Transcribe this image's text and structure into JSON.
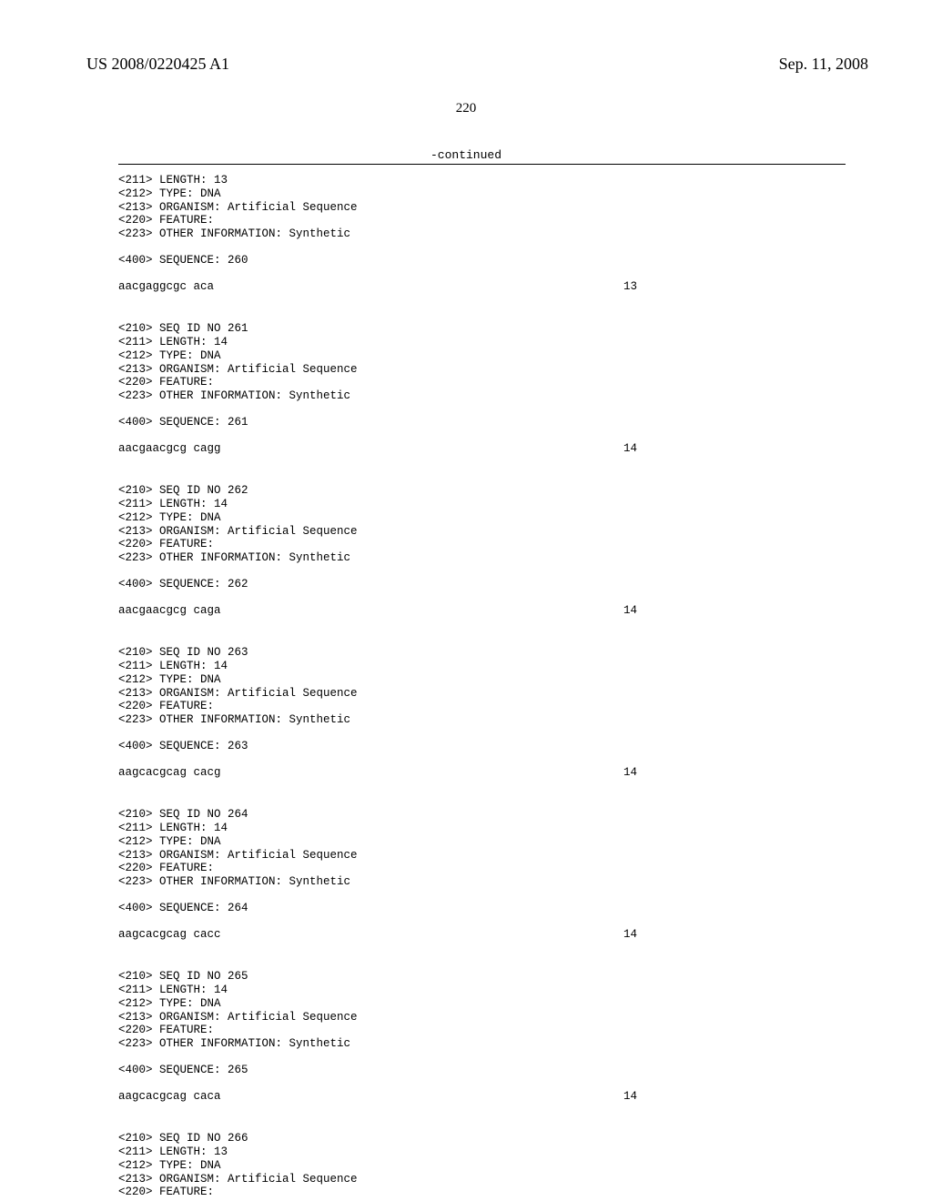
{
  "header": {
    "left": "US 2008/0220425 A1",
    "right": "Sep. 11, 2008"
  },
  "pageNumber": "220",
  "continued": "-continued",
  "blocks": [
    {
      "isFirst": true,
      "meta": [
        "<211> LENGTH: 13",
        "<212> TYPE: DNA",
        "<213> ORGANISM: Artificial Sequence",
        "<220> FEATURE:",
        "<223> OTHER INFORMATION: Synthetic"
      ],
      "seqLabel": "<400> SEQUENCE: 260",
      "sequence": "aacgaggcgc aca",
      "length": "13"
    },
    {
      "meta": [
        "<210> SEQ ID NO 261",
        "<211> LENGTH: 14",
        "<212> TYPE: DNA",
        "<213> ORGANISM: Artificial Sequence",
        "<220> FEATURE:",
        "<223> OTHER INFORMATION: Synthetic"
      ],
      "seqLabel": "<400> SEQUENCE: 261",
      "sequence": "aacgaacgcg cagg",
      "length": "14"
    },
    {
      "meta": [
        "<210> SEQ ID NO 262",
        "<211> LENGTH: 14",
        "<212> TYPE: DNA",
        "<213> ORGANISM: Artificial Sequence",
        "<220> FEATURE:",
        "<223> OTHER INFORMATION: Synthetic"
      ],
      "seqLabel": "<400> SEQUENCE: 262",
      "sequence": "aacgaacgcg caga",
      "length": "14"
    },
    {
      "meta": [
        "<210> SEQ ID NO 263",
        "<211> LENGTH: 14",
        "<212> TYPE: DNA",
        "<213> ORGANISM: Artificial Sequence",
        "<220> FEATURE:",
        "<223> OTHER INFORMATION: Synthetic"
      ],
      "seqLabel": "<400> SEQUENCE: 263",
      "sequence": "aagcacgcag cacg",
      "length": "14"
    },
    {
      "meta": [
        "<210> SEQ ID NO 264",
        "<211> LENGTH: 14",
        "<212> TYPE: DNA",
        "<213> ORGANISM: Artificial Sequence",
        "<220> FEATURE:",
        "<223> OTHER INFORMATION: Synthetic"
      ],
      "seqLabel": "<400> SEQUENCE: 264",
      "sequence": "aagcacgcag cacc",
      "length": "14"
    },
    {
      "meta": [
        "<210> SEQ ID NO 265",
        "<211> LENGTH: 14",
        "<212> TYPE: DNA",
        "<213> ORGANISM: Artificial Sequence",
        "<220> FEATURE:",
        "<223> OTHER INFORMATION: Synthetic"
      ],
      "seqLabel": "<400> SEQUENCE: 265",
      "sequence": "aagcacgcag caca",
      "length": "14"
    },
    {
      "isLast": true,
      "meta": [
        "<210> SEQ ID NO 266",
        "<211> LENGTH: 13",
        "<212> TYPE: DNA",
        "<213> ORGANISM: Artificial Sequence",
        "<220> FEATURE:"
      ]
    }
  ]
}
